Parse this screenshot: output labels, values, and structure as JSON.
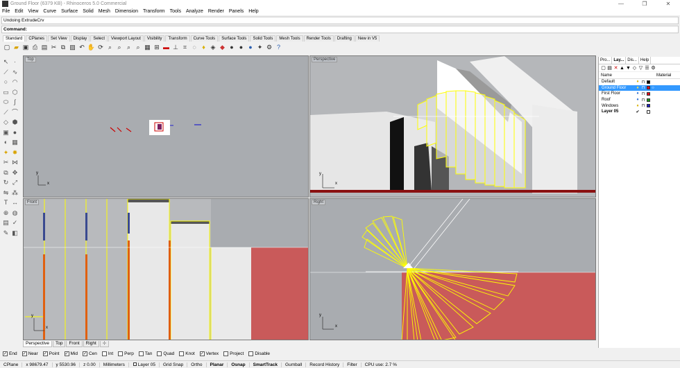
{
  "window": {
    "title": "Ground Floor (6379 KB) - Rhinoceros 5.0 Commercial",
    "controls": [
      "—",
      "❐",
      "✕"
    ]
  },
  "menu": [
    "File",
    "Edit",
    "View",
    "Curve",
    "Surface",
    "Solid",
    "Mesh",
    "Dimension",
    "Transform",
    "Tools",
    "Analyze",
    "Render",
    "Panels",
    "Help"
  ],
  "command_history": "Undoing ExtrudeCrv",
  "command_prompt": "Command:",
  "toolbar_tabs": [
    "Standard",
    "CPlanes",
    "Set View",
    "Display",
    "Select",
    "Viewport Layout",
    "Visibility",
    "Transform",
    "Curve Tools",
    "Surface Tools",
    "Solid Tools",
    "Mesh Tools",
    "Render Tools",
    "Drafting",
    "New in V5"
  ],
  "viewports": {
    "top": "Top",
    "perspective": "Perspective",
    "front": "Front",
    "right": "Right"
  },
  "axis": {
    "x": "x",
    "y": "y"
  },
  "viewport_tabs": [
    "Perspective",
    "Top",
    "Front",
    "Right",
    "⊹"
  ],
  "osnaps": [
    {
      "label": "End",
      "checked": true
    },
    {
      "label": "Near",
      "checked": true
    },
    {
      "label": "Point",
      "checked": true
    },
    {
      "label": "Mid",
      "checked": true
    },
    {
      "label": "Cen",
      "checked": true
    },
    {
      "label": "Int",
      "checked": false
    },
    {
      "label": "Perp",
      "checked": false
    },
    {
      "label": "Tan",
      "checked": false
    },
    {
      "label": "Quad",
      "checked": false
    },
    {
      "label": "Knot",
      "checked": false
    },
    {
      "label": "Vertex",
      "checked": true
    },
    {
      "label": "Project",
      "checked": false
    },
    {
      "label": "Disable",
      "checked": false
    }
  ],
  "status": {
    "cplane": "CPlane",
    "x": "x 98679.47",
    "y": "y 5530.96",
    "z": "z 0.00",
    "units": "Millimeters",
    "layer": "Layer 05",
    "toggles": [
      "Grid Snap",
      "Ortho",
      "Planar",
      "Osnap",
      "SmartTrack",
      "Gumball",
      "Record History",
      "Filter"
    ],
    "cpu": "CPU use: 2.7 %"
  },
  "panel": {
    "tabs": [
      "Pro...",
      "Lay...",
      "Dis...",
      "Help"
    ],
    "col_name": "Name",
    "col_material": "Material",
    "layers": [
      {
        "name": "Default",
        "color": "#000000",
        "selected": false
      },
      {
        "name": "Ground Floor",
        "color": "#e8001c",
        "selected": true
      },
      {
        "name": "First Floor",
        "color": "#e8001c",
        "selected": false
      },
      {
        "name": "Roof",
        "color": "#1a9c1a",
        "selected": false
      },
      {
        "name": "Windows",
        "color": "#2020c8",
        "selected": false
      },
      {
        "name": "Layer 05",
        "color": "#ffffff",
        "selected": false,
        "current": true
      }
    ]
  }
}
